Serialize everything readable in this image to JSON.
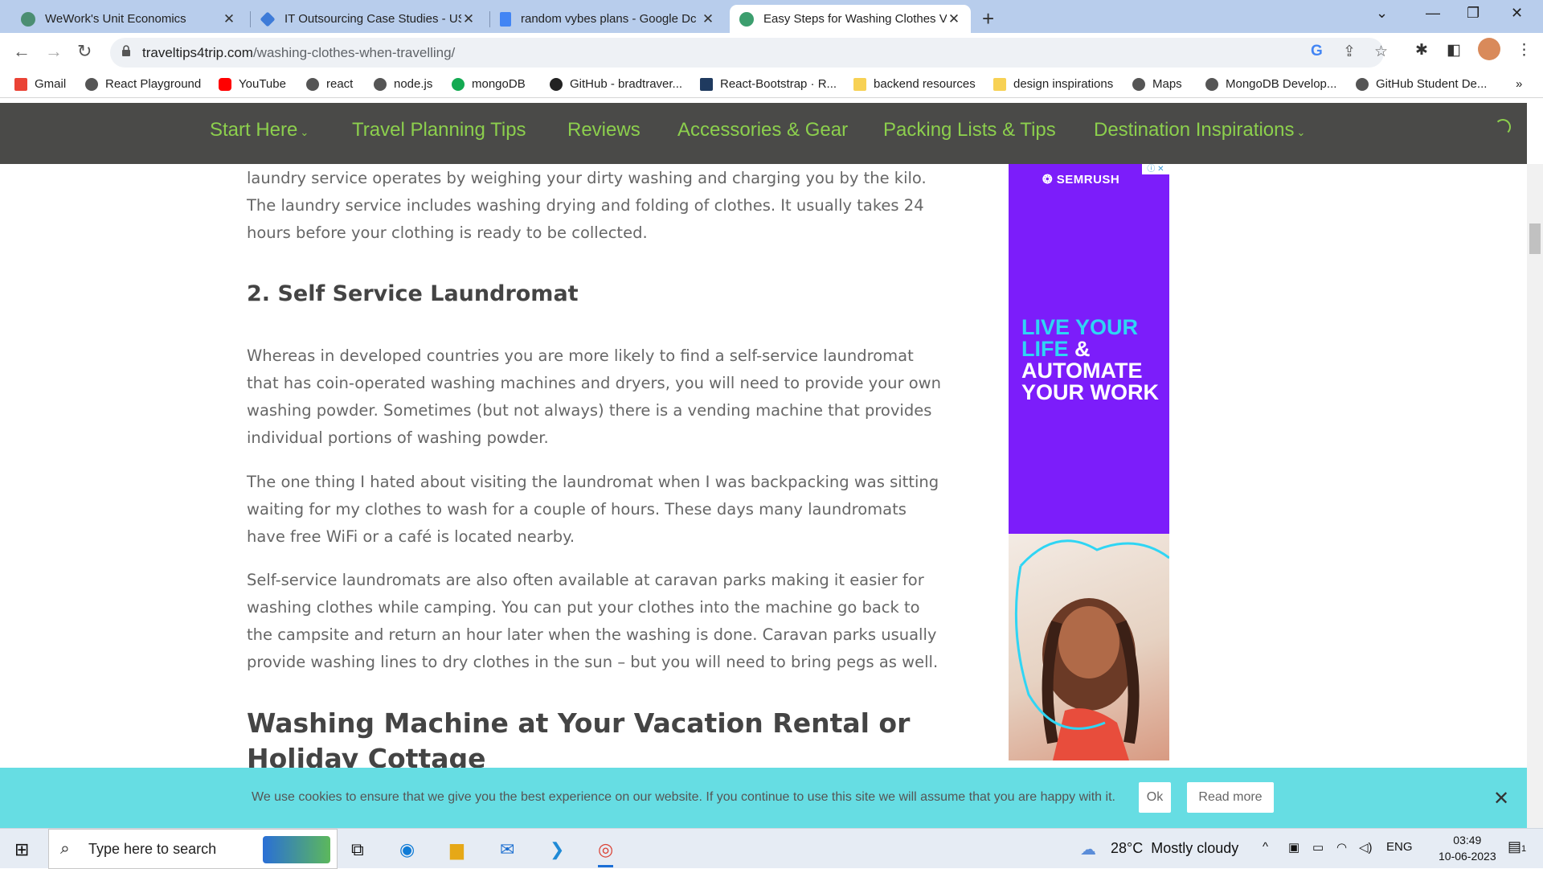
{
  "browser": {
    "tabs": [
      {
        "title": "WeWork's Unit Economics",
        "icon": "openai-icon",
        "color": "#4b8e72",
        "active": false
      },
      {
        "title": "IT Outsourcing Case Studies - US",
        "icon": "diamond-icon",
        "color": "#3e7bd8",
        "active": false
      },
      {
        "title": "random vybes plans - Google Dc",
        "icon": "google-docs-icon",
        "color": "#4285f4",
        "active": false
      },
      {
        "title": "Easy Steps for Washing Clothes V",
        "icon": "globe-icon",
        "color": "#3c9e6e",
        "active": true
      }
    ],
    "new_tab_glyph": "+",
    "close_glyph": "✕",
    "url_host": "traveltips4trip.com",
    "url_path": "/washing-clothes-when-travelling/"
  },
  "bookmarks": [
    {
      "label": "Gmail",
      "color": "#ea4335"
    },
    {
      "label": "React Playground",
      "color": "#555555"
    },
    {
      "label": "YouTube",
      "color": "#ff0000"
    },
    {
      "label": "react",
      "color": "#555555"
    },
    {
      "label": "node.js",
      "color": "#555555"
    },
    {
      "label": "mongoDB",
      "color": "#13aa52"
    },
    {
      "label": "GitHub - bradtraver...",
      "color": "#222222"
    },
    {
      "label": "React-Bootstrap · R...",
      "color": "#1f3a5f"
    },
    {
      "label": "backend resources",
      "color": "#f7d154"
    },
    {
      "label": "design inspirations",
      "color": "#f7d154"
    },
    {
      "label": "Maps",
      "color": "#555555"
    },
    {
      "label": "MongoDB Develop...",
      "color": "#555555"
    },
    {
      "label": "GitHub Student De...",
      "color": "#555555"
    }
  ],
  "bookmarks_more": "»",
  "site_nav": [
    {
      "label": "Start Here",
      "dropdown": true
    },
    {
      "label": "Travel Planning Tips",
      "dropdown": false
    },
    {
      "label": "Reviews",
      "dropdown": false
    },
    {
      "label": "Accessories & Gear",
      "dropdown": false
    },
    {
      "label": "Packing Lists & Tips",
      "dropdown": false
    },
    {
      "label": "Destination Inspirations",
      "dropdown": true
    }
  ],
  "dropdown_glyph": "⌄",
  "article": {
    "intro": "laundry service operates by weighing your dirty washing and charging you by the kilo.  The laundry service includes washing drying and folding of clothes.  It usually takes 24 hours before your clothing is ready to be collected.",
    "section_heading": "2. Self Service Laundromat",
    "p1": "Whereas in developed countries you are more likely to find a self-service laundromat that has coin-operated washing machines and dryers, you will need to provide your own washing powder. Sometimes (but not always) there is a vending machine that provides individual portions of washing powder.",
    "p2": "The one thing I hated about visiting the laundromat when I was backpacking was sitting waiting for my clothes to wash for a couple of hours.  These days many laundromats have free WiFi or a café is located nearby.",
    "p3": "Self-service laundromats are also often available at caravan parks making it easier for washing clothes while camping.  You can put your clothes into the machine go back to the campsite and return an hour later when the washing is done.  Caravan parks usually provide washing lines to dry clothes in the sun – but you will need to bring pegs as well.",
    "h2": "Washing Machine at Your Vacation Rental or Holiday Cottage"
  },
  "ad": {
    "brand": "SEMRUSH",
    "line1": "LIVE YOUR",
    "line2a": "LIFE",
    "line2b": " &",
    "line3": "AUTOMATE",
    "line4": "YOUR WORK",
    "accent_color": "#2fd5f4",
    "bg_color": "#7c1dfa"
  },
  "cookie": {
    "message": "We use cookies to ensure that we give you the best experience on our website. If you continue to use this site we will assume that you are happy with it.",
    "ok": "Ok",
    "read_more": "Read more",
    "close": "✕"
  },
  "taskbar": {
    "search_placeholder": "Type here to search",
    "temperature": "28°C",
    "weather": "Mostly cloudy",
    "lang": "ENG",
    "time": "03:49",
    "date": "10-06-2023",
    "notifications": "1"
  }
}
